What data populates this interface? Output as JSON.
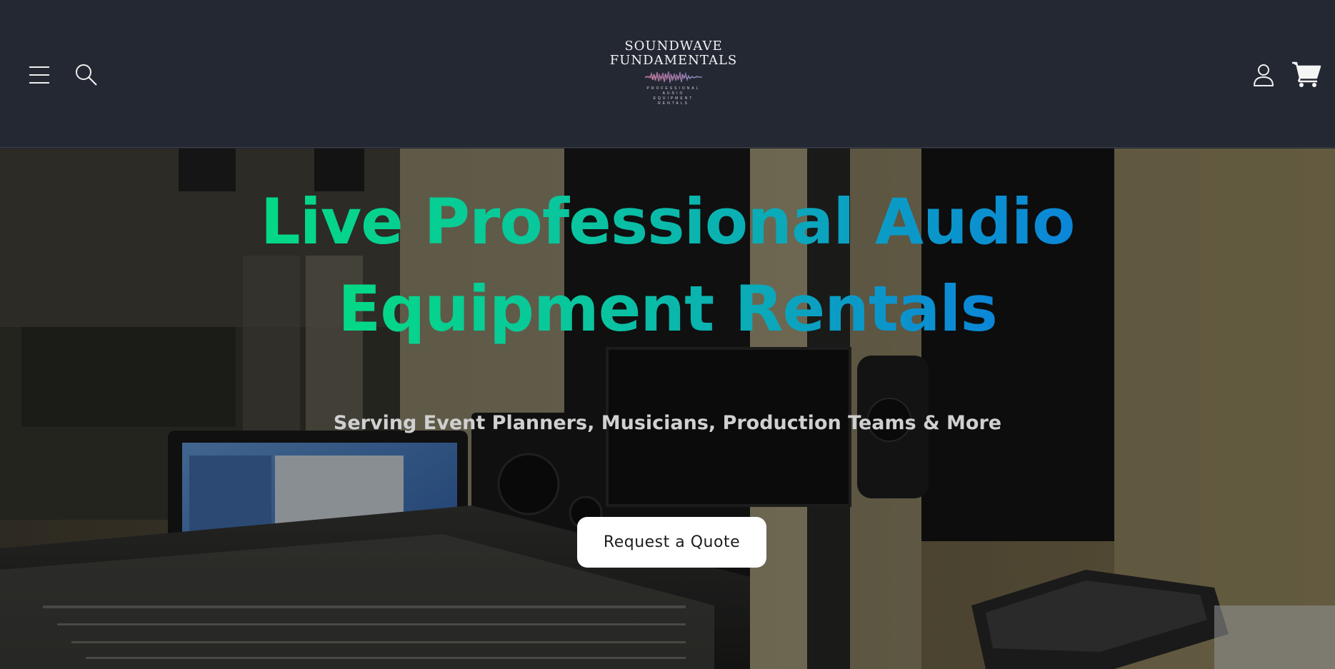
{
  "header": {
    "logo": {
      "line1": "SOUNDWAVE",
      "line2": "FUNDAMENTALS",
      "tagline": "PROFESSIONAL AUDIO EQUIPMENT RENTALS"
    },
    "icons": {
      "menu": "menu-icon",
      "search": "search-icon",
      "account": "account-icon",
      "cart": "cart-icon"
    }
  },
  "hero": {
    "headline_line1": "Live Professional Audio",
    "headline_line2": "Equipment Rentals",
    "subheadline": "Serving Event Planners, Musicians, Production Teams & More",
    "cta_label": "Request a Quote",
    "gradient_start": "#04d985",
    "gradient_end": "#0b86d8"
  },
  "colors": {
    "header_bg": "#242833",
    "cta_bg": "#ffffff"
  }
}
